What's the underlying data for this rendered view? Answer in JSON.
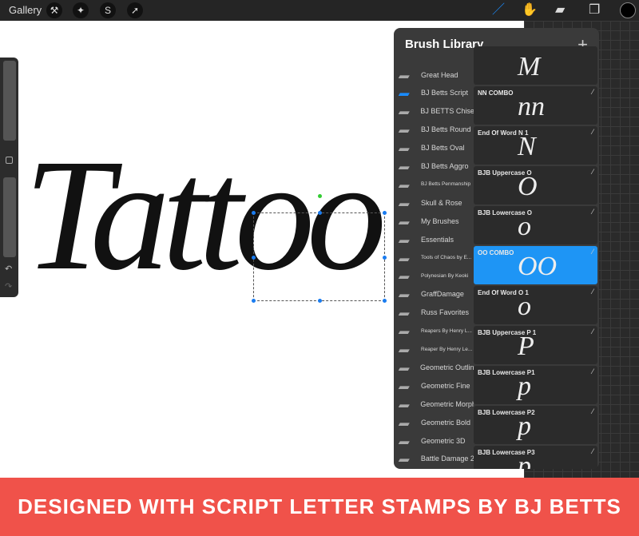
{
  "toolbar": {
    "gallery": "Gallery",
    "left_icons": [
      "wrench-icon",
      "magic-wand-icon",
      "selection-s-icon",
      "arrow-transform-icon"
    ],
    "right_icons": [
      "brush-icon",
      "smudge-icon",
      "eraser-icon",
      "layers-icon",
      "color-swatch-icon"
    ],
    "active_tool": "brush",
    "accent": "#1a8cff",
    "color": "#000000"
  },
  "canvas": {
    "text": "Tattoo"
  },
  "brush_library": {
    "title": "Brush Library",
    "add": "+",
    "libraries": [
      "Great Head",
      "BJ Betts Script",
      "BJ BETTS Chisel",
      "BJ Betts Round",
      "BJ Betts Oval",
      "BJ Betts Aggro",
      "BJ Betts Penmanship",
      "Skull & Rose",
      "My Brushes",
      "Essentials",
      "Tools of Chaos by E...",
      "Polynesian By Keoki",
      "GraffDamage",
      "Russ Favorites",
      "Reapers By Henry L...",
      "Reaper By Henry Le...",
      "Geometric Outline",
      "Geometric Fine",
      "Geometric Morph",
      "Geometric Bold",
      "Geometric 3D",
      "Battle Damage 2"
    ],
    "selected_library": "BJ Betts Script",
    "brushes": [
      {
        "name": "",
        "glyph": "M"
      },
      {
        "name": "NN COMBO",
        "glyph": "nn"
      },
      {
        "name": "End Of Word N 1",
        "glyph": "N"
      },
      {
        "name": "BJB Uppercase O",
        "glyph": "O"
      },
      {
        "name": "BJB Lowercase O",
        "glyph": "o"
      },
      {
        "name": "OO COMBO",
        "glyph": "OO"
      },
      {
        "name": "End Of Word O 1",
        "glyph": "o"
      },
      {
        "name": "BJB Uppercase P 1",
        "glyph": "P"
      },
      {
        "name": "BJB Lowercase P1",
        "glyph": "p"
      },
      {
        "name": "BJB Lowercase P2",
        "glyph": "p"
      },
      {
        "name": "BJB Lowercase P3",
        "glyph": "p"
      }
    ],
    "selected_brush": "OO COMBO"
  },
  "banner": {
    "text": "DESIGNED WITH SCRIPT LETTER STAMPS BY BJ BETTS",
    "color": "#f0524a"
  }
}
